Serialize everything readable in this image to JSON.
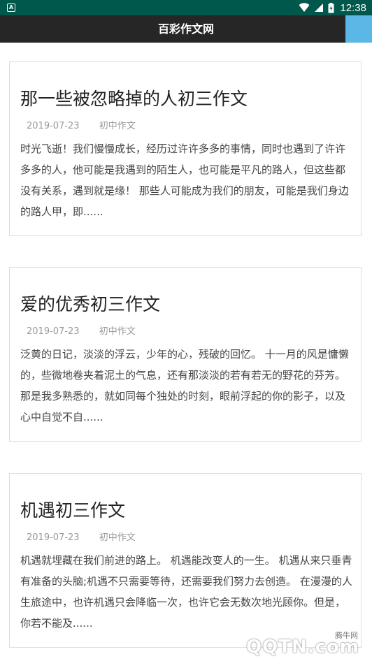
{
  "status_bar": {
    "time": "12:38",
    "icons": [
      "a-notification-icon",
      "wifi-icon",
      "signal-icon",
      "battery-icon"
    ]
  },
  "app_bar": {
    "title": "百彩作文网",
    "accent_color": "#5bb7e6"
  },
  "articles": [
    {
      "title": "那一些被忽略掉的人初三作文",
      "date": "2019-07-23",
      "category": "初中作文",
      "excerpt": "时光飞逝！我们慢慢成长，经历过许许多多的事情，同时也遇到了许许多多的人，他可能是我遇到的陌生人，也可能是平凡的路人，但这些都没有关系，遇到就是缘！ 那些人可能成为我们的朋友，可能是我们身边的路人甲，即......"
    },
    {
      "title": "爱的优秀初三作文",
      "date": "2019-07-23",
      "category": "初中作文",
      "excerpt": "泛黄的日记，淡淡的浮云，少年的心，残破的回忆。 十一月的风是慵懒的，些微地卷夹着泥土的气息，还有那淡淡的若有若无的野花的芬芳。那是我多熟悉的，就如同每个独处的时刻，眼前浮起的你的影子，以及心中自觉不自......"
    },
    {
      "title": "机遇初三作文",
      "date": "2019-07-23",
      "category": "初中作文",
      "excerpt": "机遇就埋藏在我们前进的路上。 机遇能改变人的一生。 机遇从来只垂青有准备的头脑;机遇不只需要等待，还需要我们努力去创造。 在漫漫的人生旅途中，也许机遇只会降临一次，也许它会无数次地光顾你。但是，你若不能及......"
    }
  ],
  "watermark": {
    "cn_text": "腾牛网",
    "logo_text": "QQTN.com"
  }
}
